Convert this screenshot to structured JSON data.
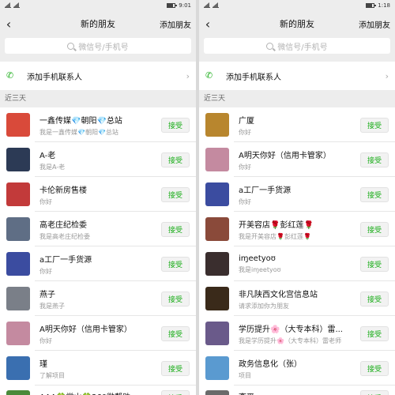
{
  "left": {
    "status": {
      "time": "9:01"
    },
    "nav": {
      "back": "‹",
      "title": "新的朋友",
      "action": "添加朋友"
    },
    "search": {
      "placeholder": "微信号/手机号"
    },
    "add_contacts": {
      "label": "添加手机联系人"
    },
    "section": "近三天",
    "accept_label": "接受",
    "items": [
      {
        "name": "一鑫传媒💎朝阳💎总站",
        "sub": "我是一鑫传媒💎朝阳💎总站",
        "color": "#d94a3a"
      },
      {
        "name": "A-老",
        "sub": "我是A-老",
        "color": "#2c3a55"
      },
      {
        "name": "卡伦新房售楼",
        "sub": "你好",
        "color": "#c23a3a"
      },
      {
        "name": "高老庄纪检委",
        "sub": "我是高老庄纪检委",
        "color": "#5f6e85"
      },
      {
        "name": "a工厂一手货源",
        "sub": "你好",
        "color": "#3b4ca0"
      },
      {
        "name": "燕子",
        "sub": "我是燕子",
        "color": "#7a7f88"
      },
      {
        "name": "A明天你好（信用卡管家）",
        "sub": "你好",
        "color": "#c48aa0"
      },
      {
        "name": "瑾",
        "sub": "了解项目",
        "color": "#3a6fb0"
      },
      {
        "name": "AAA🍀常山🍀360微帮助",
        "sub": "",
        "color": "#4a8a3a"
      }
    ]
  },
  "right": {
    "status": {
      "time": "1:18"
    },
    "nav": {
      "back": "‹",
      "title": "新的朋友",
      "action": "添加朋友"
    },
    "search": {
      "placeholder": "微信号/手机号"
    },
    "add_contacts": {
      "label": "添加手机联系人"
    },
    "section": "近三天",
    "accept_label": "接受",
    "items": [
      {
        "name": "广厦",
        "sub": "你好",
        "color": "#b8862e"
      },
      {
        "name": "A明天你好（信用卡管家）",
        "sub": "你好",
        "color": "#c48aa0"
      },
      {
        "name": "a工厂一手货源",
        "sub": "你好",
        "color": "#3b4ca0"
      },
      {
        "name": "开美容店🌹彭红莲🌹",
        "sub": "我是开美容店🌹彭红莲🌹",
        "color": "#8a4a3a"
      },
      {
        "name": "iɱeetyoʊ",
        "sub": "我是iɱeetyoʊ",
        "color": "#3a2e2e"
      },
      {
        "name": "非凡陕西文化宫信息站",
        "sub": "请求添加你为朋友",
        "color": "#3a2a1a"
      },
      {
        "name": "学历提升🌸（大专本科）雷...",
        "sub": "我是学历提升🌸（大专本科）雷老师",
        "color": "#6a5a8a"
      },
      {
        "name": "政务信息化（张）",
        "sub": "项目",
        "color": "#5a9ad0"
      },
      {
        "name": "李平",
        "sub": "",
        "color": "#6a6a6a"
      }
    ]
  }
}
